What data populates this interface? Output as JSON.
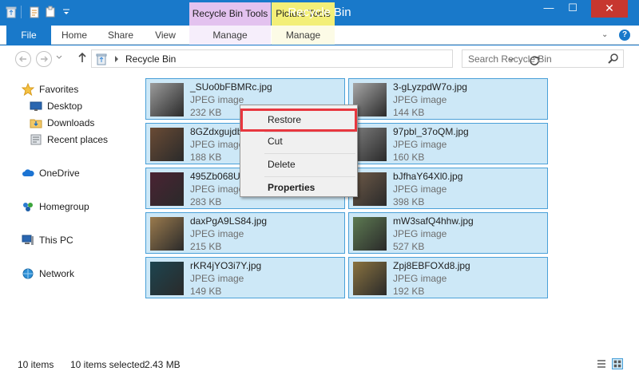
{
  "window": {
    "title": "Recycle Bin",
    "contextual_tabs": [
      "Recycle Bin Tools",
      "Picture Tools"
    ],
    "minimize_glyph": "—",
    "maximize_glyph": "☐",
    "close_glyph": "✕"
  },
  "ribbon": {
    "tabs": [
      "File",
      "Home",
      "Share",
      "View",
      "Manage",
      "Manage"
    ],
    "help_glyph": "?",
    "expand_glyph": "⌄"
  },
  "address": {
    "path": "Recycle Bin",
    "search_placeholder": "Search Recycle Bin"
  },
  "nav": {
    "items": [
      {
        "label": "Favorites",
        "icon": "star-icon"
      },
      {
        "label": "Desktop",
        "icon": "desktop-icon"
      },
      {
        "label": "Downloads",
        "icon": "downloads-icon"
      },
      {
        "label": "Recent places",
        "icon": "recent-places-icon"
      },
      {
        "label": "OneDrive",
        "icon": "cloud-icon"
      },
      {
        "label": "Homegroup",
        "icon": "homegroup-icon"
      },
      {
        "label": "This PC",
        "icon": "computer-icon"
      },
      {
        "label": "Network",
        "icon": "network-icon"
      }
    ]
  },
  "files": [
    {
      "name": "_SUo0bFBMRc.jpg",
      "type": "JPEG image",
      "size": "232 KB",
      "thumb": "#9b9b9b"
    },
    {
      "name": "3-gLyzpdW7o.jpg",
      "type": "JPEG image",
      "size": "144 KB",
      "thumb": "#a7a7a7"
    },
    {
      "name": "8GZdxgujdb",
      "type": "JPEG image",
      "size": "188 KB",
      "thumb": "#6a4b35"
    },
    {
      "name": "97pbl_37oQM.jpg",
      "type": "JPEG image",
      "size": "160 KB",
      "thumb": "#7d7d7d"
    },
    {
      "name": "495Zb068UI",
      "type": "JPEG image",
      "size": "283 KB",
      "thumb": "#4a2333"
    },
    {
      "name": "bJfhaY64Xl0.jpg",
      "type": "JPEG image",
      "size": "398 KB",
      "thumb": "#6e5a48"
    },
    {
      "name": "daxPgA9LS84.jpg",
      "type": "JPEG image",
      "size": "215 KB",
      "thumb": "#9a7a4d"
    },
    {
      "name": "mW3safQ4hhw.jpg",
      "type": "JPEG image",
      "size": "527 KB",
      "thumb": "#5d7a52"
    },
    {
      "name": "rKR4jYO3i7Y.jpg",
      "type": "JPEG image",
      "size": "149 KB",
      "thumb": "#1d4550"
    },
    {
      "name": "Zpj8EBFOXd8.jpg",
      "type": "JPEG image",
      "size": "192 KB",
      "thumb": "#8a7340"
    }
  ],
  "context_menu": {
    "items": [
      "Restore",
      "Cut",
      "Delete",
      "Properties"
    ]
  },
  "status": {
    "count": "10 items",
    "selected": "10 items selected",
    "size": "2.43 MB"
  },
  "colors": {
    "accent": "#1979ca",
    "selection_fill": "#cde8f7",
    "selection_border": "#4aa0d8",
    "highlight": "#e8373f"
  }
}
